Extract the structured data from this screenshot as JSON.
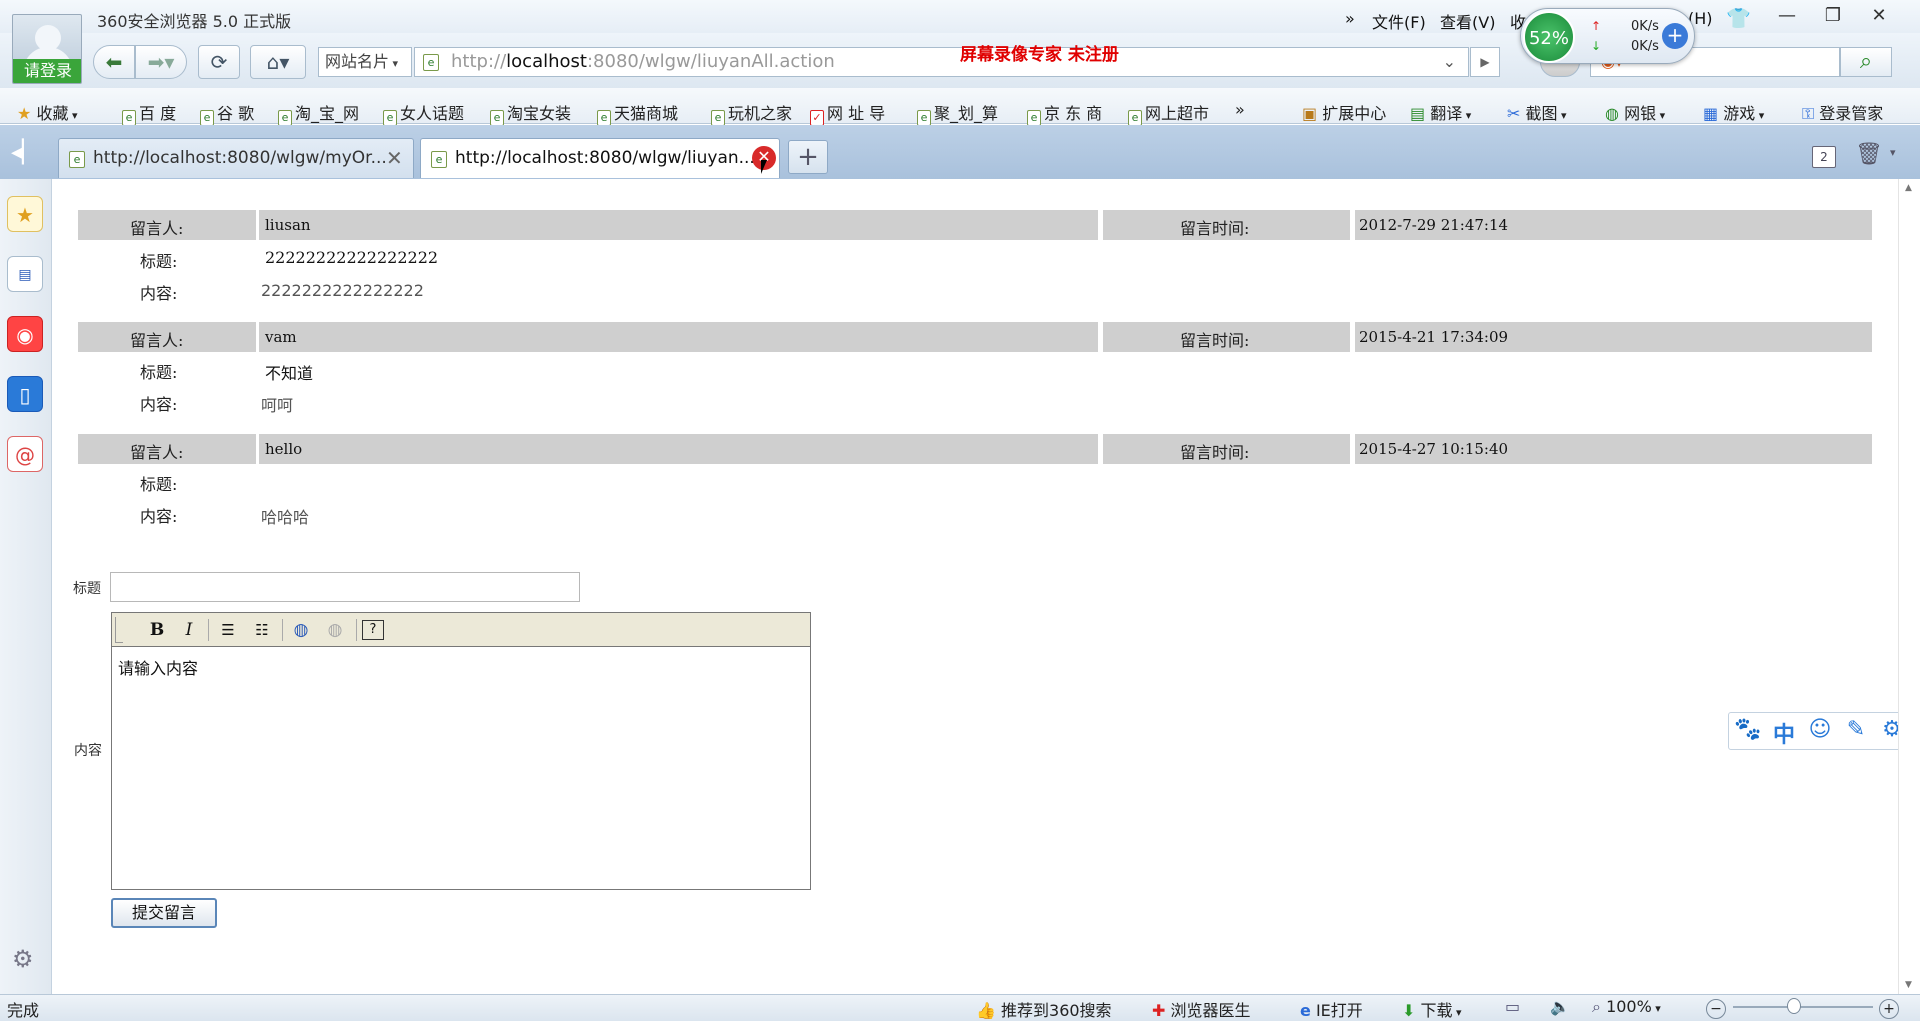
{
  "window": {
    "title": "360安全浏览器 5.0 正式版",
    "menus": [
      "文件(F)",
      "查看(V)",
      "收",
      "(H)"
    ],
    "menu_more": "»",
    "controls": {
      "minimize": "—",
      "restore": "❐",
      "close": "✕"
    }
  },
  "account": {
    "login_label": "请登录"
  },
  "speed": {
    "percent": "52%",
    "up": "0K/s",
    "down": "0K/s"
  },
  "addressbar": {
    "site_card_label": "网站名片",
    "url_scheme": "http://",
    "url_host": "localhost",
    "url_rest": ":8080/wlgw/liuyanAll.action",
    "recorder_watermark": "屏幕录像专家  未注册"
  },
  "bookmarks": {
    "favorites_label": "收藏",
    "items": [
      "百 度",
      "谷 歌",
      "淘_宝_网",
      "女人话题",
      "淘宝女装",
      "天猫商城",
      "玩机之家",
      "网 址 导",
      "聚_划_算",
      "京 东 商",
      "网上超市"
    ],
    "more": "»",
    "right_items": [
      "扩展中心",
      "翻译",
      "截图",
      "网银",
      "游戏",
      "登录管家"
    ]
  },
  "tabs": [
    {
      "title": "http://localhost:8080/wlgw/myOr..."
    },
    {
      "title": "http://localhost:8080/wlgw/liuyan..."
    }
  ],
  "tab_count": "2",
  "messages": {
    "label_author": "留言人:",
    "label_time": "留言时间:",
    "label_title": "标题:",
    "label_content": "内容:",
    "items": [
      {
        "author": "liusan",
        "time": "2012-7-29 21:47:14",
        "title": "22222222222222222",
        "content": "2222222222222222"
      },
      {
        "author": "vam",
        "time": "2015-4-21 17:34:09",
        "title": "不知道",
        "content": "呵呵"
      },
      {
        "author": "hello",
        "time": "2015-4-27 10:15:40",
        "title": "",
        "content": "哈哈哈"
      }
    ]
  },
  "form": {
    "title_label": "标题",
    "title_value": "",
    "content_label": "内容",
    "editor_placeholder": "请输入内容",
    "toolbar": {
      "bold": "B",
      "italic": "I",
      "help": "?"
    },
    "submit_label": "提交留言"
  },
  "floatbar": {
    "ime_label": "中"
  },
  "status": {
    "left": "完成",
    "items": [
      "推荐到360搜索",
      "浏览器医生",
      "IE打开",
      "下载"
    ],
    "zoom": "100%",
    "zoom_minus": "−",
    "zoom_plus": "+"
  }
}
